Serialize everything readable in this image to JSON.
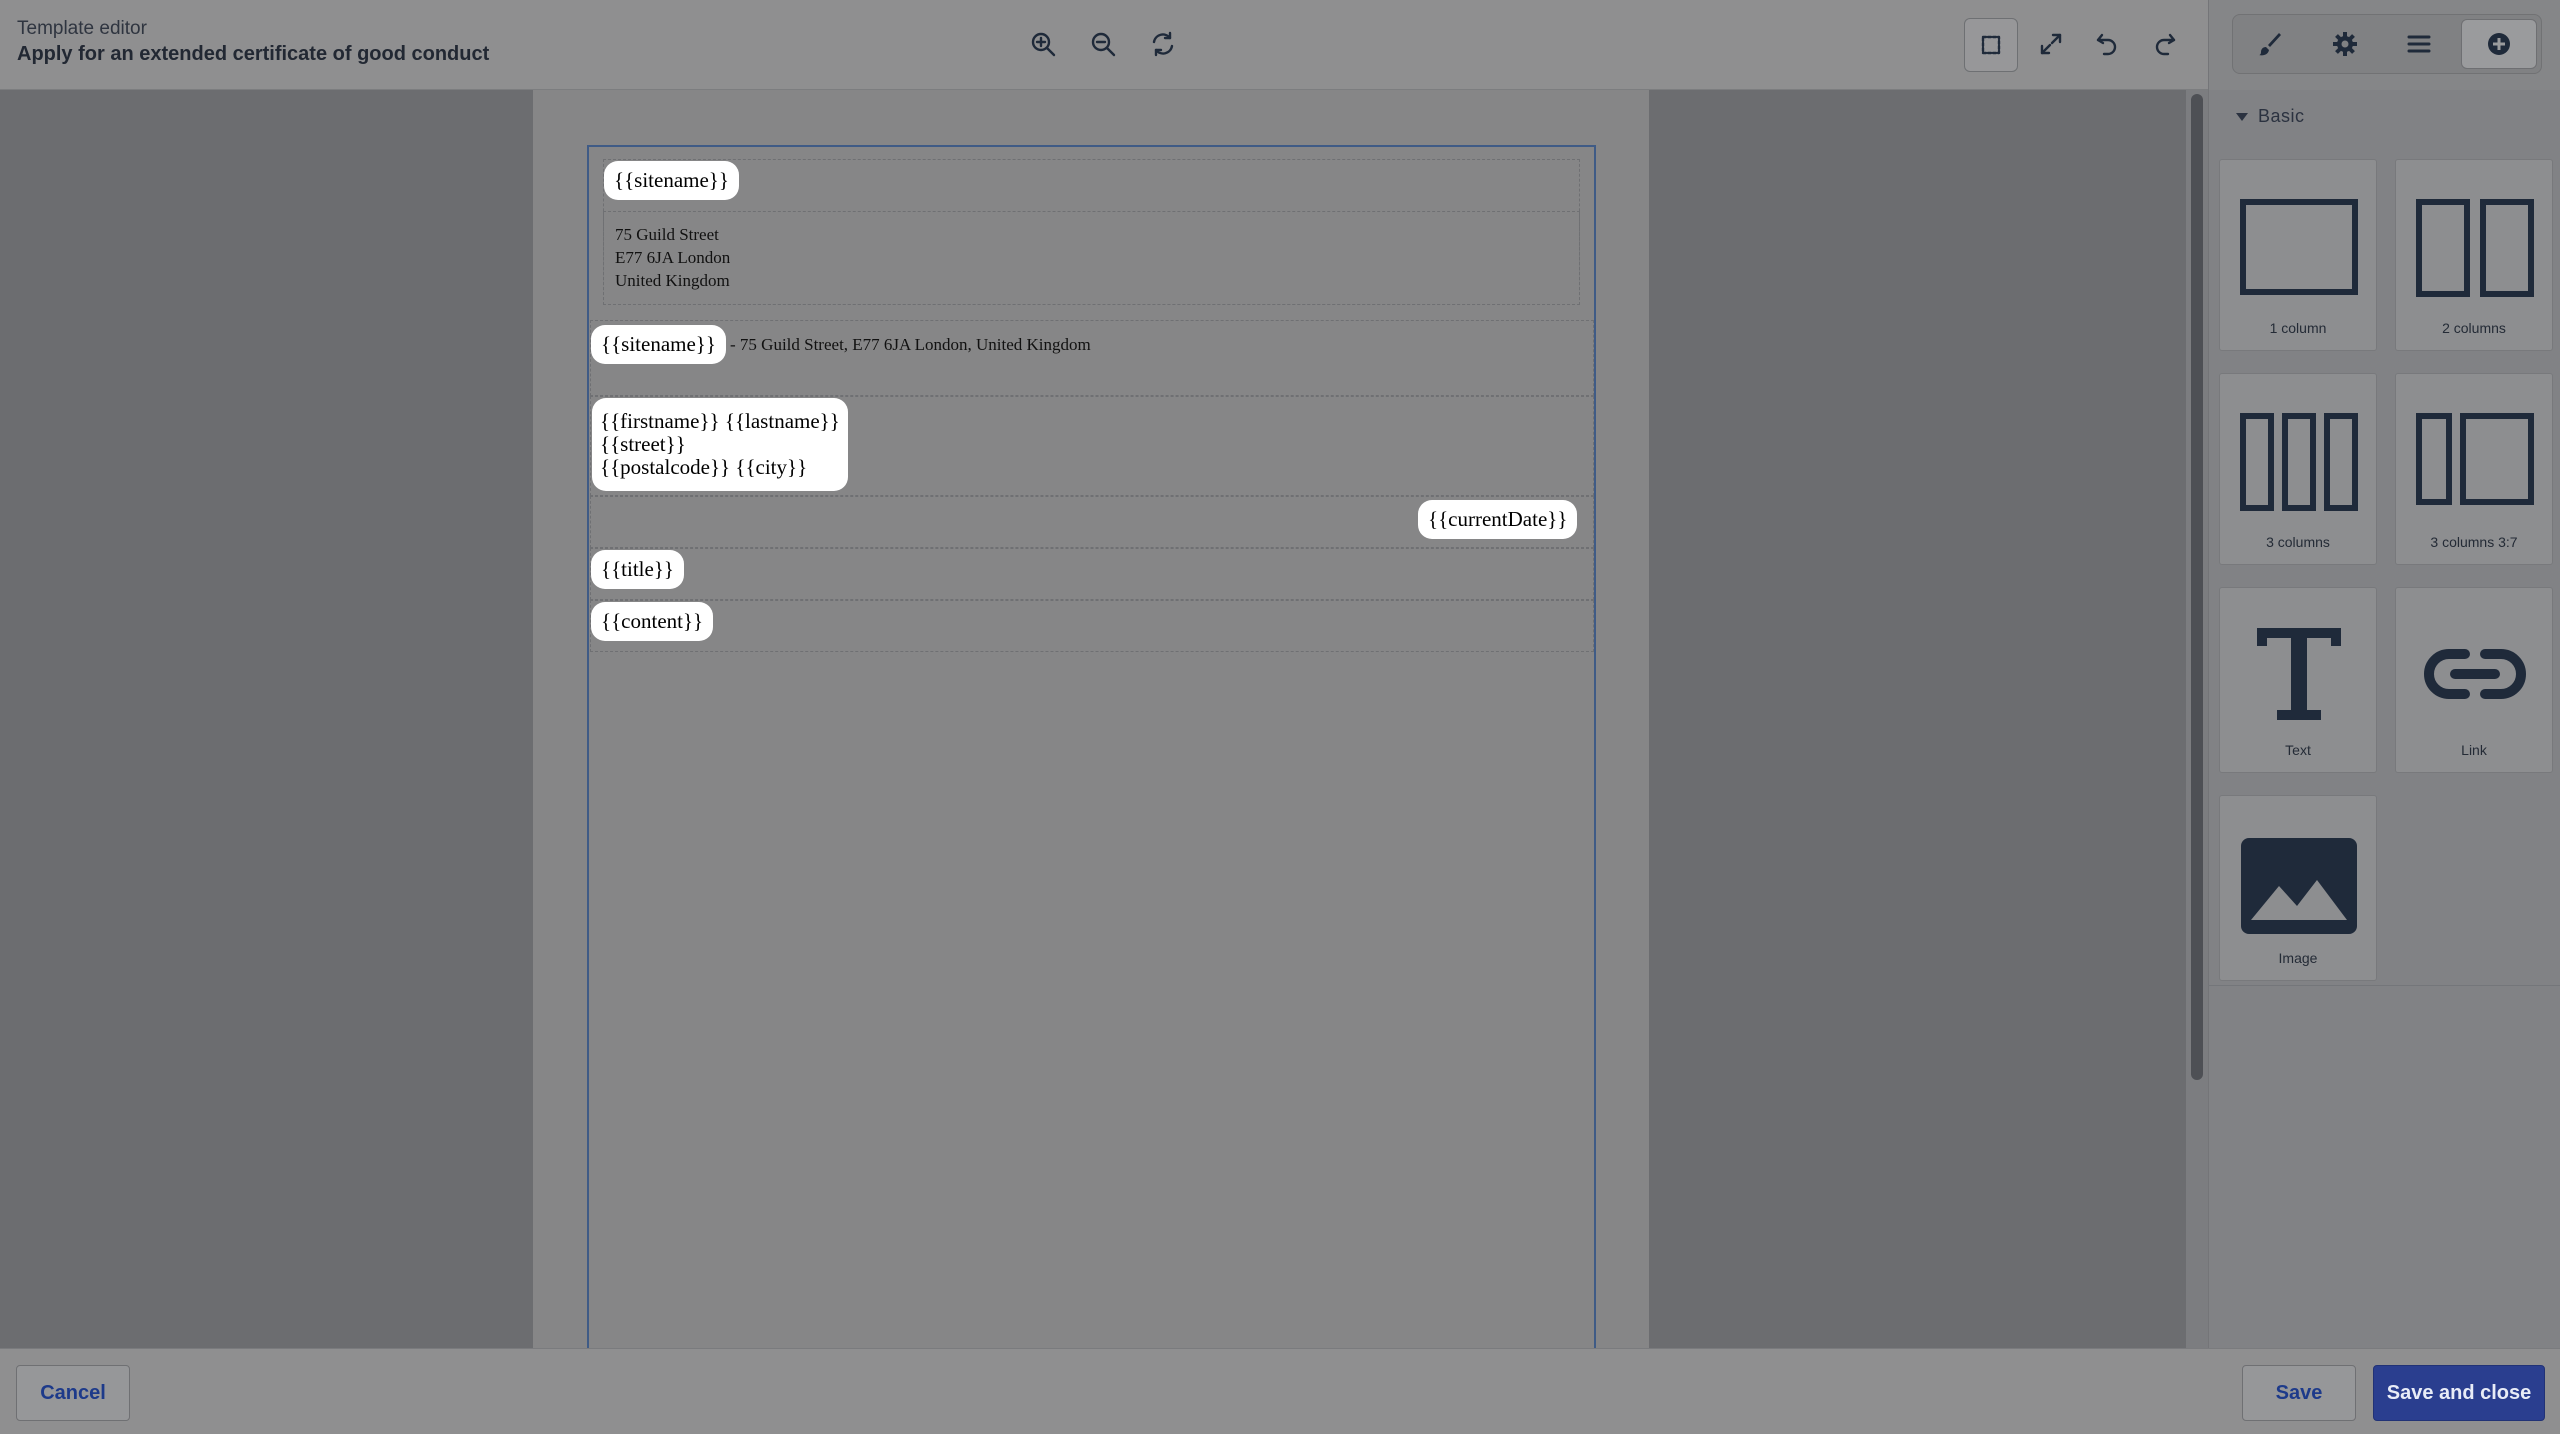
{
  "header": {
    "subtitle": "Template editor",
    "title": "Apply for an extended certificate of good conduct"
  },
  "toolbar": {
    "center": [
      "zoom-in-icon",
      "zoom-out-icon",
      "refresh-icon"
    ],
    "right": [
      "select-outline-icon",
      "fullscreen-icon",
      "undo-icon",
      "redo-icon"
    ]
  },
  "panel": {
    "tabs": [
      "brush-icon",
      "gear-icon",
      "layers-icon",
      "add-block-icon"
    ],
    "section_title": "Basic",
    "blocks": [
      {
        "label": "1 column",
        "icon": "one-column-icon"
      },
      {
        "label": "2 columns",
        "icon": "two-columns-icon"
      },
      {
        "label": "3 columns",
        "icon": "three-columns-icon"
      },
      {
        "label": "3 columns 3:7",
        "icon": "columns-3-7-icon"
      },
      {
        "label": "Text",
        "icon": "text-icon"
      },
      {
        "label": "Link",
        "icon": "link-icon"
      },
      {
        "label": "Image",
        "icon": "image-icon"
      }
    ]
  },
  "document": {
    "sitename_tag": "{{sitename}}",
    "address_lines": [
      "75 Guild Street",
      "E77 6JA London",
      "United Kingdom"
    ],
    "sender_tag": "{{sitename}}",
    "sender_line": "- 75 Guild Street, E77 6JA London, United Kingdom",
    "recipient_lines": [
      "{{firstname}} {{lastname}}",
      "{{street}}",
      "{{postalcode}}  {{city}}"
    ],
    "date_tag": "{{currentDate}}",
    "title_tag": "{{title}}",
    "content_tag": "{{content}}"
  },
  "footer": {
    "cancel_label": "Cancel",
    "save_label": "Save",
    "save_close_label": "Save and close"
  },
  "colors": {
    "primary": "#2a3e8f",
    "frame": "#3f5b86"
  }
}
